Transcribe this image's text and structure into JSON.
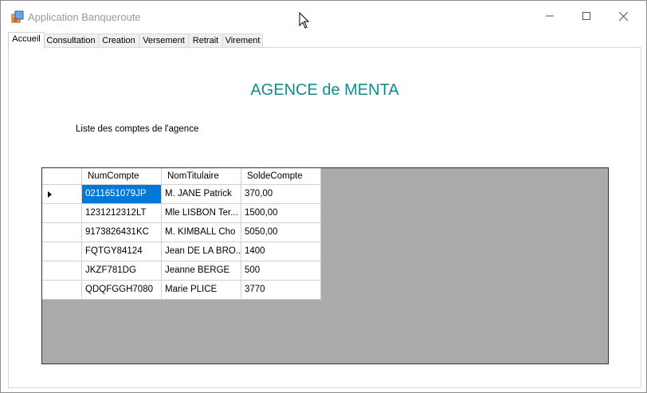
{
  "window": {
    "title": "Application Banqueroute"
  },
  "tabs": [
    {
      "label": "Accueil"
    },
    {
      "label": "Consultation"
    },
    {
      "label": "Creation"
    },
    {
      "label": "Versement"
    },
    {
      "label": "Retrait"
    },
    {
      "label": "Virement"
    }
  ],
  "main": {
    "heading": "AGENCE de MENTA",
    "sublabel": "Liste des comptes de l'agence",
    "heading_color": "#138c8c"
  },
  "grid": {
    "columns": [
      "NumCompte",
      "NomTitulaire",
      "SoldeCompte"
    ],
    "rows": [
      [
        "0211651079JP",
        "M. JANE Patrick",
        "370,00"
      ],
      [
        "1231212312LT",
        "Mle LISBON Ter...",
        "1500,00"
      ],
      [
        "9173826431KC",
        "M. KIMBALL Cho",
        "5050,00"
      ],
      [
        "FQTGY84124",
        "Jean DE LA BRO...",
        "1400"
      ],
      [
        "JKZF781DG",
        "Jeanne BERGE",
        "500"
      ],
      [
        "QDQFGGH7080",
        "Marie PLICE",
        "3770"
      ]
    ],
    "selection_color": "#0078d7"
  }
}
